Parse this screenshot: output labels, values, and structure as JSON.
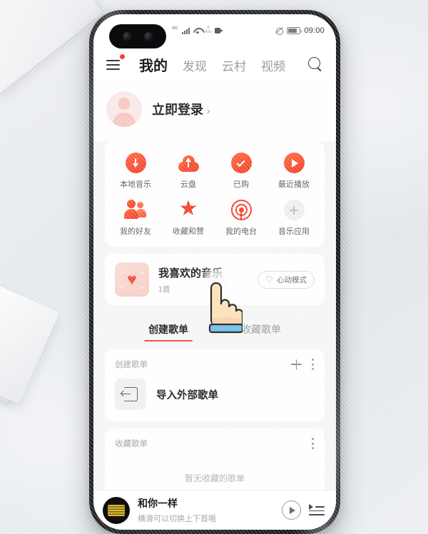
{
  "statusbar": {
    "network_label": "4G",
    "data_rate": "0 K/s",
    "time": "09:00",
    "icons": [
      "signal-icon",
      "wifi-icon",
      "data-rate-icon",
      "video-icon",
      "mute-icon",
      "battery-icon"
    ]
  },
  "appbar": {
    "menu_icon": "hamburger-menu-icon",
    "search_icon": "search-icon",
    "tabs": [
      {
        "label": "我的",
        "active": true
      },
      {
        "label": "发现",
        "active": false
      },
      {
        "label": "云村",
        "active": false
      },
      {
        "label": "视频",
        "active": false
      }
    ]
  },
  "login": {
    "label": "立即登录",
    "chevron": "›"
  },
  "quick_grid": [
    {
      "label": "本地音乐",
      "icon": "download-circle-icon"
    },
    {
      "label": "云盘",
      "icon": "cloud-upload-icon"
    },
    {
      "label": "已购",
      "icon": "check-circle-icon"
    },
    {
      "label": "最近播放",
      "icon": "play-circle-icon"
    },
    {
      "label": "我的好友",
      "icon": "friends-icon"
    },
    {
      "label": "收藏和赞",
      "icon": "star-icon"
    },
    {
      "label": "我的电台",
      "icon": "radio-icon"
    },
    {
      "label": "音乐应用",
      "icon": "plus-circle-icon"
    }
  ],
  "liked": {
    "title": "我喜欢的音乐",
    "subtitle": "1首",
    "art_icon": "heart-art-icon",
    "mode_button": {
      "label": "心动模式",
      "icon": "heartbeat-icon"
    }
  },
  "playlist_tabs": [
    {
      "label": "创建歌单",
      "active": true
    },
    {
      "label": "收藏歌单",
      "active": false
    }
  ],
  "created_section": {
    "title": "创建歌单",
    "add_icon": "plus-icon",
    "more_icon": "more-dots-icon",
    "item": {
      "label": "导入外部歌单",
      "icon": "import-arrow-icon"
    }
  },
  "favorite_section": {
    "title": "收藏歌单",
    "more_icon": "more-dots-icon",
    "empty_text": "暂无收藏的歌单"
  },
  "mini_player": {
    "title": "和你一样",
    "subtitle": "横滑可以切换上下首哦",
    "play_icon": "play-icon",
    "playlist_icon": "playlist-icon"
  },
  "colors": {
    "accent": "#f4412c",
    "accent_light": "#ff6a3d",
    "tab_underline": "#f04a3b",
    "badge": "#f5413a"
  }
}
